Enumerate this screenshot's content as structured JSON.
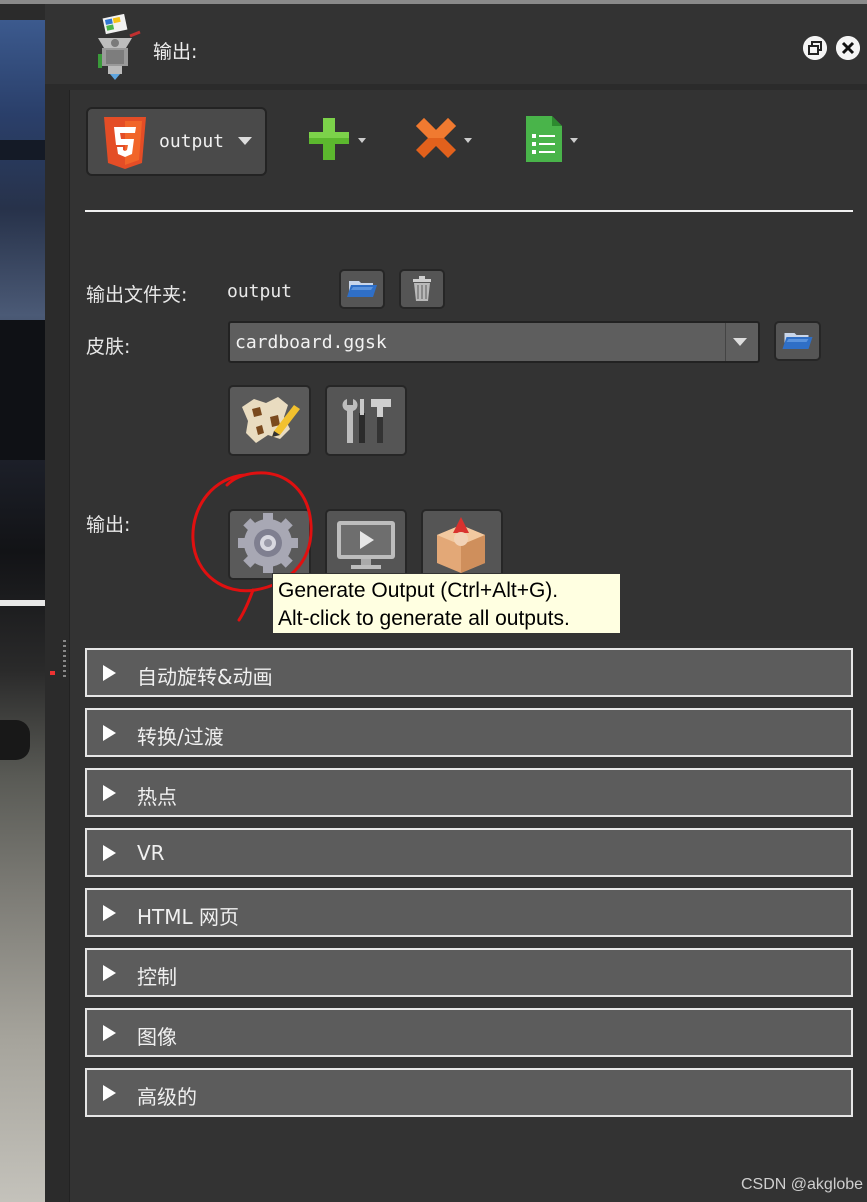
{
  "window": {
    "title": "输出:"
  },
  "toolbar": {
    "format_label": "output"
  },
  "output_folder": {
    "label": "输出文件夹:",
    "value": "output"
  },
  "skin": {
    "label": "皮肤:",
    "selected": "cardboard.ggsk"
  },
  "output_section": {
    "label": "输出:"
  },
  "tooltip": {
    "line1": "Generate Output (Ctrl+Alt+G).",
    "line2": "Alt-click to generate all outputs."
  },
  "sections": [
    {
      "label": "自动旋转&动画"
    },
    {
      "label": "转换/过渡"
    },
    {
      "label": "热点"
    },
    {
      "label": "VR"
    },
    {
      "label": "HTML 网页"
    },
    {
      "label": "控制"
    },
    {
      "label": "图像"
    },
    {
      "label": "高级的"
    }
  ],
  "watermark": "CSDN @akglobe",
  "colors": {
    "panel_bg": "#333333",
    "section_bg": "#5c5c5c",
    "tooltip_bg": "#ffffe1",
    "annotation_red": "#e01010",
    "add_green": "#5cb82e",
    "remove_orange": "#e2611c"
  }
}
